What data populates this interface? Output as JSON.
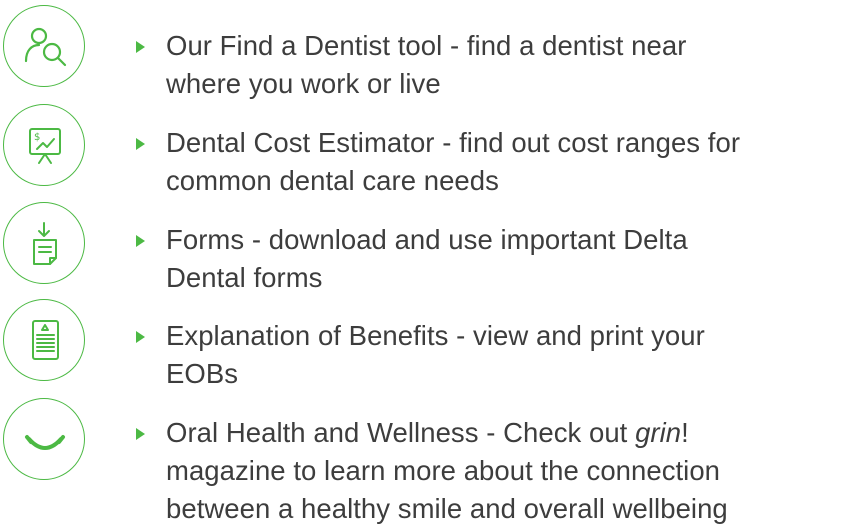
{
  "items": [
    {
      "icon": "find-dentist-icon",
      "line1": "Our Find a Dentist tool - find a dentist near",
      "line2": "where you work or live"
    },
    {
      "icon": "cost-estimator-icon",
      "line1": "Dental Cost Estimator - find out cost ranges for",
      "line2": "common dental care needs"
    },
    {
      "icon": "forms-download-icon",
      "line1": "Forms - download and use important Delta",
      "line2": "Dental forms"
    },
    {
      "icon": "eob-document-icon",
      "line1": "Explanation of Benefits - view and print your",
      "line2": "EOBs"
    },
    {
      "icon": "smile-icon",
      "line1_pre": "Oral Health and Wellness - Check out ",
      "line1_em": "grin",
      "line1_post": "!",
      "line2": "magazine to learn more about the connection",
      "line3": "between a healthy smile and overall wellbeing"
    }
  ],
  "colors": {
    "accent": "#4cb944",
    "text": "#3d3d3d"
  }
}
